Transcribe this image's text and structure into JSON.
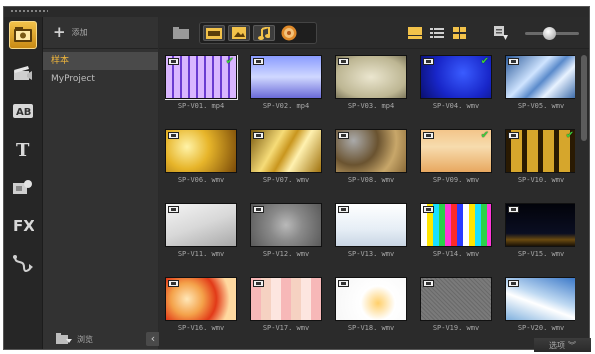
{
  "library": {
    "add_label": "添加",
    "folders": [
      "样本",
      "MyProject"
    ],
    "selected_folder": "样本",
    "browse_label": "浏览"
  },
  "toolbar": {
    "zoom_level": 0.45
  },
  "colors": {
    "accent": "#f0b63c",
    "check": "#3ccf3c"
  },
  "clips": [
    {
      "name": "SP-V01. mp4",
      "checked": true,
      "icon": "film-icon"
    },
    {
      "name": "SP-V02. mp4",
      "checked": false,
      "icon": "film-icon"
    },
    {
      "name": "SP-V03. mp4",
      "checked": false,
      "icon": "film-icon"
    },
    {
      "name": "SP-V04. wmv",
      "checked": true,
      "icon": "film-icon"
    },
    {
      "name": "SP-V05. wmv",
      "checked": false,
      "icon": "film-icon"
    },
    {
      "name": "SP-V06. wmv",
      "checked": false,
      "icon": "film-icon"
    },
    {
      "name": "SP-V07. wmv",
      "checked": false,
      "icon": "film-icon"
    },
    {
      "name": "SP-V08. wmv",
      "checked": false,
      "icon": "film-icon"
    },
    {
      "name": "SP-V09. wmv",
      "checked": true,
      "icon": "film-icon"
    },
    {
      "name": "SP-V10. wmv",
      "checked": true,
      "icon": "film-icon"
    },
    {
      "name": "SP-V11. wmv",
      "checked": false,
      "icon": "film-icon"
    },
    {
      "name": "SP-V12. wmv",
      "checked": false,
      "icon": "film-icon"
    },
    {
      "name": "SP-V13. wmv",
      "checked": false,
      "icon": "film-icon"
    },
    {
      "name": "SP-V14. wmv",
      "checked": false,
      "icon": "film-icon"
    },
    {
      "name": "SP-V15. wmv",
      "checked": false,
      "icon": "film-icon"
    },
    {
      "name": "SP-V16. wmv",
      "checked": false,
      "icon": "film-icon"
    },
    {
      "name": "SP-V17. wmv",
      "checked": false,
      "icon": "film-icon"
    },
    {
      "name": "SP-V18. wmv",
      "checked": false,
      "icon": "film-icon"
    },
    {
      "name": "SP-V19. wmv",
      "checked": false,
      "icon": "film-icon"
    },
    {
      "name": "SP-V20. wmv",
      "checked": false,
      "icon": "film-icon"
    }
  ],
  "footer": {
    "options_label": "选项"
  }
}
